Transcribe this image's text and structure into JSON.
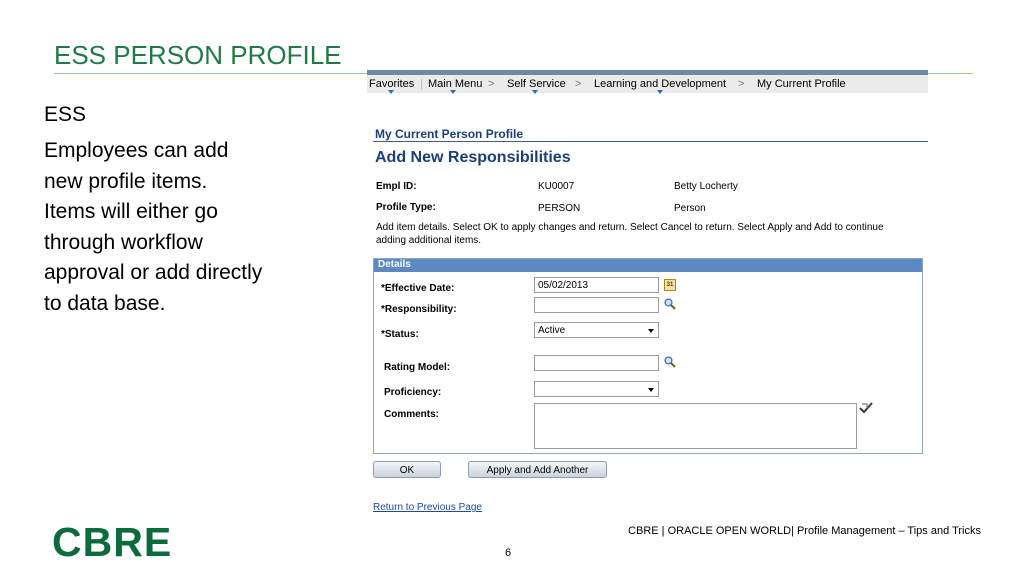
{
  "slide": {
    "title": "ESS PERSON PROFILE",
    "body_heading": "ESS",
    "body_paragraph": "Employees can add new profile items.  Items will either go through workflow approval or add directly to data base.",
    "logo": "CBRE",
    "footer": "CBRE  |  ORACLE OPEN WORLD|  Profile Management – Tips and Tricks",
    "page_number": "6"
  },
  "nav": {
    "items": [
      "Favorites",
      "Main Menu",
      "Self Service",
      "Learning and Development",
      "My Current Profile"
    ],
    "separator": ">"
  },
  "page": {
    "component_title": "My Current Person Profile",
    "heading": "Add New Responsibilities",
    "empl_id_label": "Empl ID:",
    "empl_id": "KU0007",
    "employee_name": "Betty Locherty",
    "profile_type_label": "Profile Type:",
    "profile_type": "PERSON",
    "profile_type_desc": "Person",
    "instructions": "Add item details. Select OK to apply changes and return. Select Cancel to return. Select Apply and Add to continue adding additional items."
  },
  "details": {
    "title": "Details",
    "effective_date_label": "*Effective Date:",
    "effective_date": "05/02/2013",
    "calendar_icon_text": "31",
    "responsibility_label": "*Responsibility:",
    "responsibility": "",
    "status_label": "*Status:",
    "status": "Active",
    "rating_model_label": "Rating Model:",
    "rating_model": "",
    "proficiency_label": "Proficiency:",
    "proficiency": "",
    "comments_label": "Comments:",
    "comments": ""
  },
  "buttons": {
    "ok": "OK",
    "apply_add": "Apply and Add Another"
  },
  "links": {
    "return": "Return to Previous Page"
  },
  "icons": {
    "lookup": "magnifier-icon",
    "calendar": "calendar-icon",
    "spellcheck": "spellcheck-icon",
    "dropdown": "chevron-down-icon"
  },
  "colors": {
    "title_green": "#1f7a45",
    "logo_green": "#0c6b3c",
    "ps_blue": "#1b3f7a",
    "details_header": "#5c89c2"
  }
}
